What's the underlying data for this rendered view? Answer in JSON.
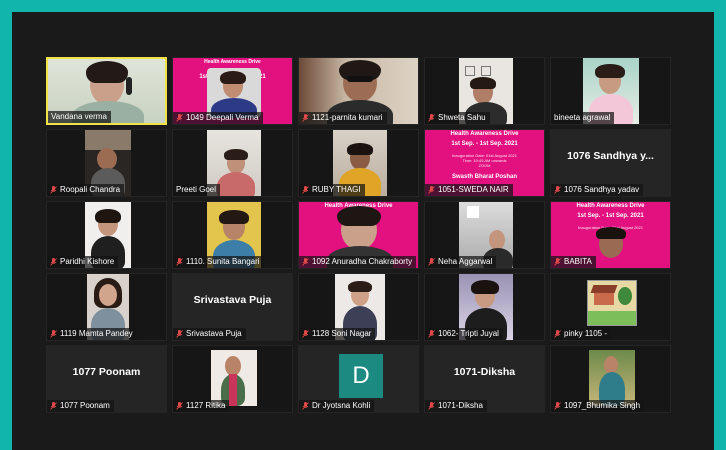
{
  "participants": [
    {
      "name": "Vandana verma",
      "active": true
    },
    {
      "name": "1049 Deepali Verma"
    },
    {
      "name": "1121-parnita kumari"
    },
    {
      "name": "Shweta Sahu"
    },
    {
      "name": "bineeta agrawal"
    },
    {
      "name": "Roopali Chandra"
    },
    {
      "name": "Preeti Goel"
    },
    {
      "name": "RUBY THAGI"
    },
    {
      "name": "1051-SWEDA NAIR"
    },
    {
      "name": "1076 Sandhya yadav",
      "display": "1076 Sandhya y..."
    },
    {
      "name": "Paridhi Kishore"
    },
    {
      "name": "1110. Sunita Bangari"
    },
    {
      "name": "1092 Anuradha Chakraborty"
    },
    {
      "name": "Neha Aggarwal"
    },
    {
      "name": "BABITA"
    },
    {
      "name": "1119 Mamta Pandey"
    },
    {
      "name": "Srivastava Puja",
      "display": "Srivastava Puja"
    },
    {
      "name": "1128 Soni Nagar"
    },
    {
      "name": "1062- Tripti Juyal"
    },
    {
      "name": "pinky 1105 -"
    },
    {
      "name": "1077 Poonam",
      "display": "1077 Poonam"
    },
    {
      "name": "1127 Ritika"
    },
    {
      "name": "Dr Jyotsna Kohli",
      "avatar": "D"
    },
    {
      "name": "1071-Diksha",
      "display": "1071-Diksha"
    },
    {
      "name": "1097_Bhumika Singh"
    }
  ],
  "poster": {
    "title": "Health Awareness Drive",
    "dates": "1st Sep. - 1st Sep. 2021",
    "inaug": "Inauguration Date: 01st August 2021",
    "time": "Time: 10:45 AM onwards",
    "platform": "ZOOM",
    "footer": "Swasth Bharat Poshan"
  },
  "icons": {
    "muted": "mic-off-icon"
  }
}
